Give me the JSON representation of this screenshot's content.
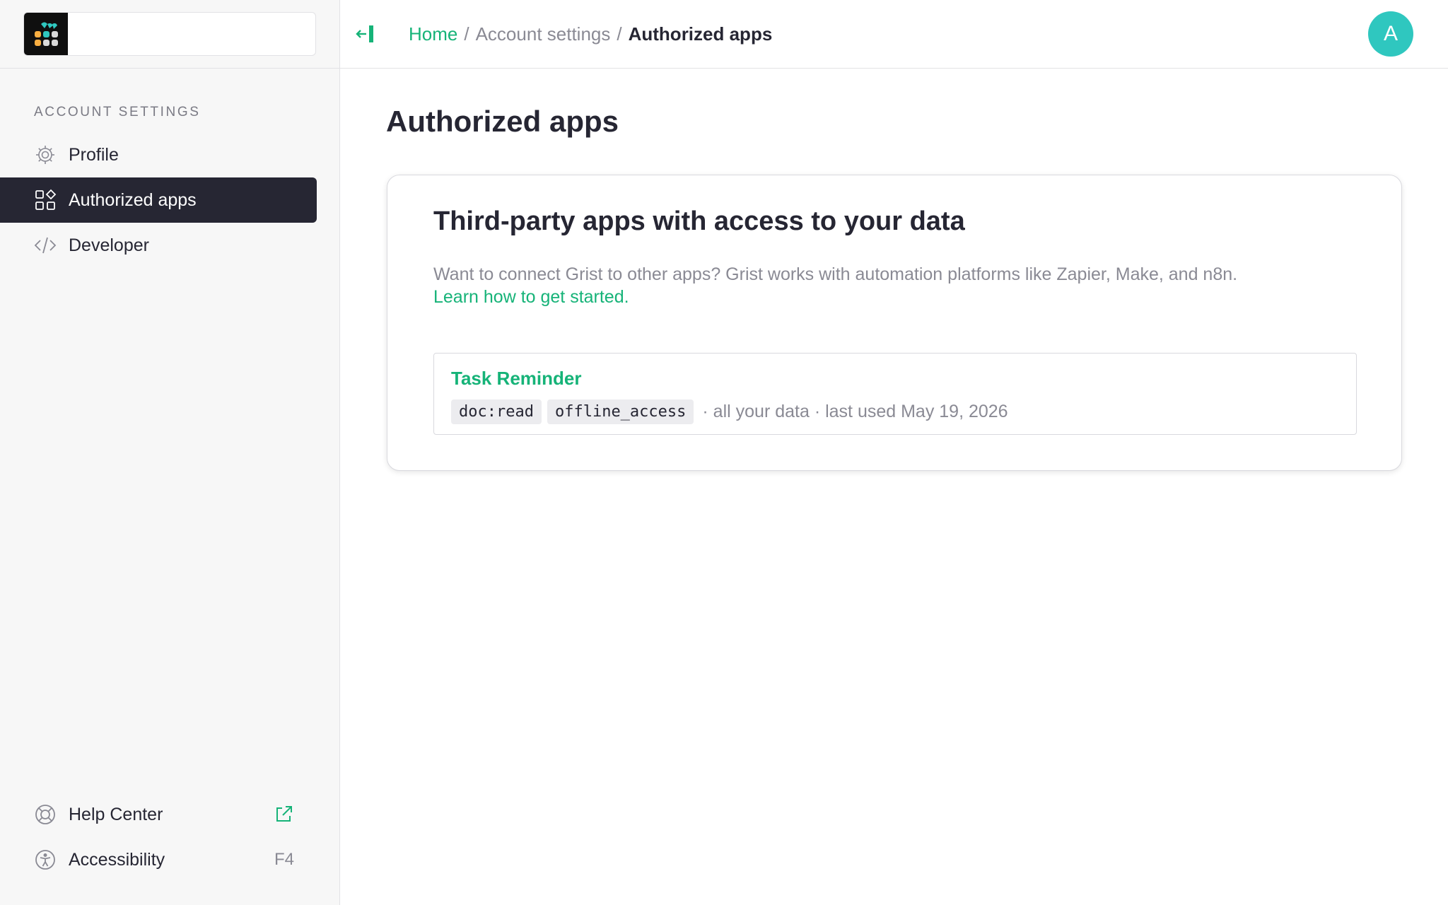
{
  "sidebar": {
    "section_title": "ACCOUNT SETTINGS",
    "items": [
      {
        "label": "Profile",
        "icon": "gear-icon"
      },
      {
        "label": "Authorized apps",
        "icon": "apps-grid-icon"
      },
      {
        "label": "Developer",
        "icon": "code-icon"
      }
    ],
    "footer": [
      {
        "label": "Help Center",
        "icon": "lifebuoy-icon"
      },
      {
        "label": "Accessibility",
        "icon": "accessibility-icon",
        "shortcut": "F4"
      }
    ]
  },
  "header": {
    "breadcrumb": {
      "home": "Home",
      "sep": "/",
      "account": "Account settings",
      "current": "Authorized apps"
    },
    "avatar_initial": "A"
  },
  "main": {
    "title": "Authorized apps",
    "card": {
      "title": "Third-party apps with access to your data",
      "description": "Want to connect Grist to other apps? Grist works with automation platforms like Zapier, Make, and n8n.",
      "learn_link": "Learn how to get started.",
      "apps": [
        {
          "name": "Task Reminder",
          "scopes": [
            "doc:read",
            "offline_access"
          ],
          "meta": "· all your data · last used May 19, 2026"
        }
      ]
    }
  },
  "colors": {
    "accent_green": "#16b378",
    "avatar_teal": "#2fc7bf",
    "sidebar_active": "#262633",
    "logo_teal": "#2fc7bf",
    "logo_orange": "#f9ae41",
    "logo_grey": "#d9d9d9"
  }
}
